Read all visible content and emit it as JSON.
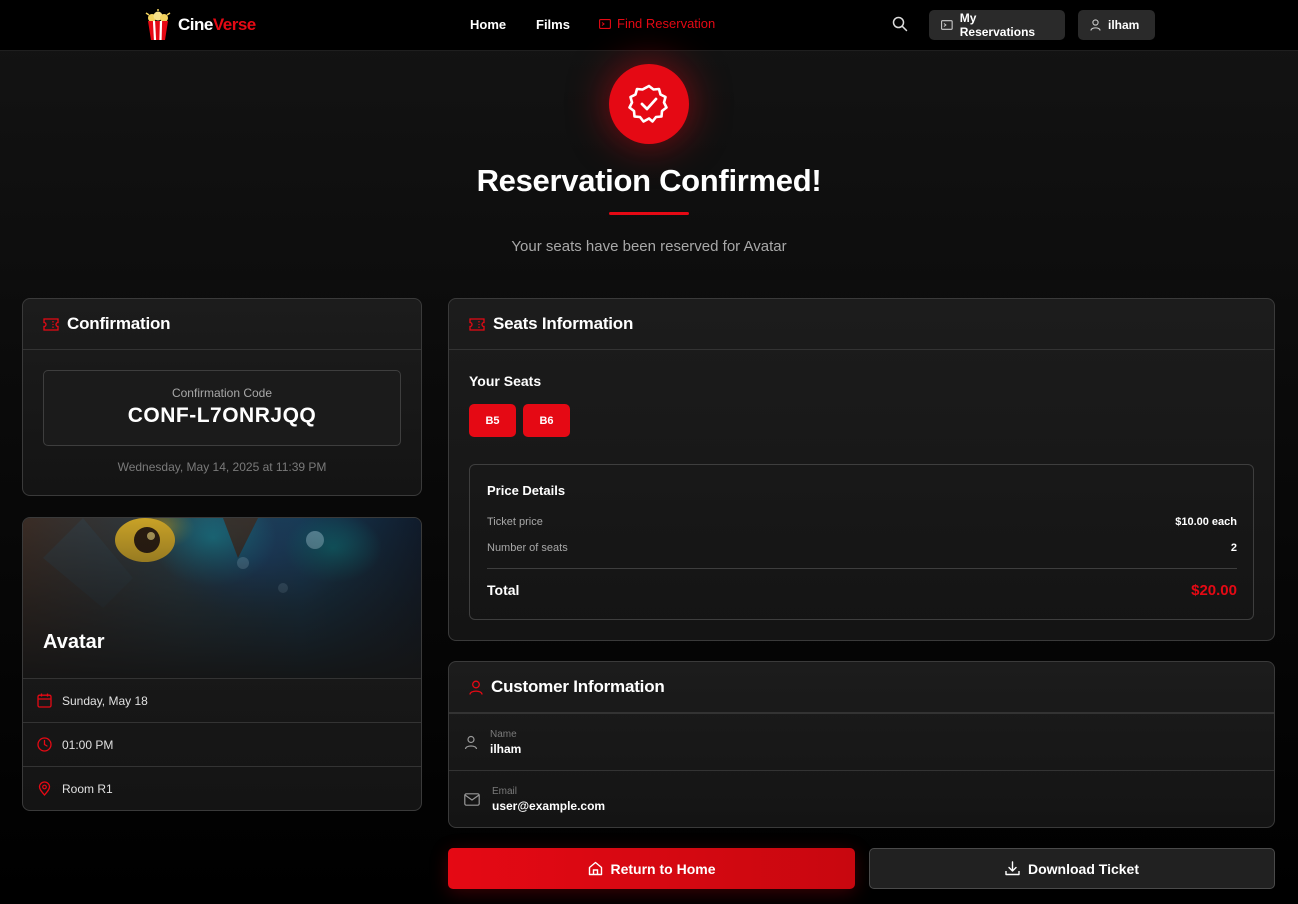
{
  "app": {
    "logo_part1": "Cine",
    "logo_part2": "Verse",
    "brand_color": "#e50914"
  },
  "nav": {
    "home": "Home",
    "films": "Films",
    "find_reservation": "Find Reservation",
    "my_reservations": "My Reservations",
    "user": "ilham"
  },
  "hero": {
    "title": "Reservation Confirmed!",
    "subtitle": "Your seats have been reserved for Avatar"
  },
  "confirmation": {
    "heading": "Confirmation",
    "code_label": "Confirmation Code",
    "code": "CONF-L7ONRJQQ",
    "date": "Wednesday, May 14, 2025 at 11:39 PM"
  },
  "movie": {
    "title": "Avatar",
    "date": "Sunday, May 18",
    "time": "01:00 PM",
    "room": "Room R1"
  },
  "seats": {
    "heading": "Seats Information",
    "your_seats": "Your Seats",
    "list": [
      "B5",
      "B6"
    ],
    "price_details": "Price Details",
    "ticket_price_label": "Ticket price",
    "ticket_price_value": "$10.00 each",
    "num_seats_label": "Number of seats",
    "num_seats_value": "2",
    "total_label": "Total",
    "total_value": "$20.00"
  },
  "customer": {
    "heading": "Customer Information",
    "name_label": "Name",
    "name_value": "ilham",
    "email_label": "Email",
    "email_value": "user@example.com"
  },
  "actions": {
    "return_home": "Return to Home",
    "download_ticket": "Download Ticket"
  }
}
